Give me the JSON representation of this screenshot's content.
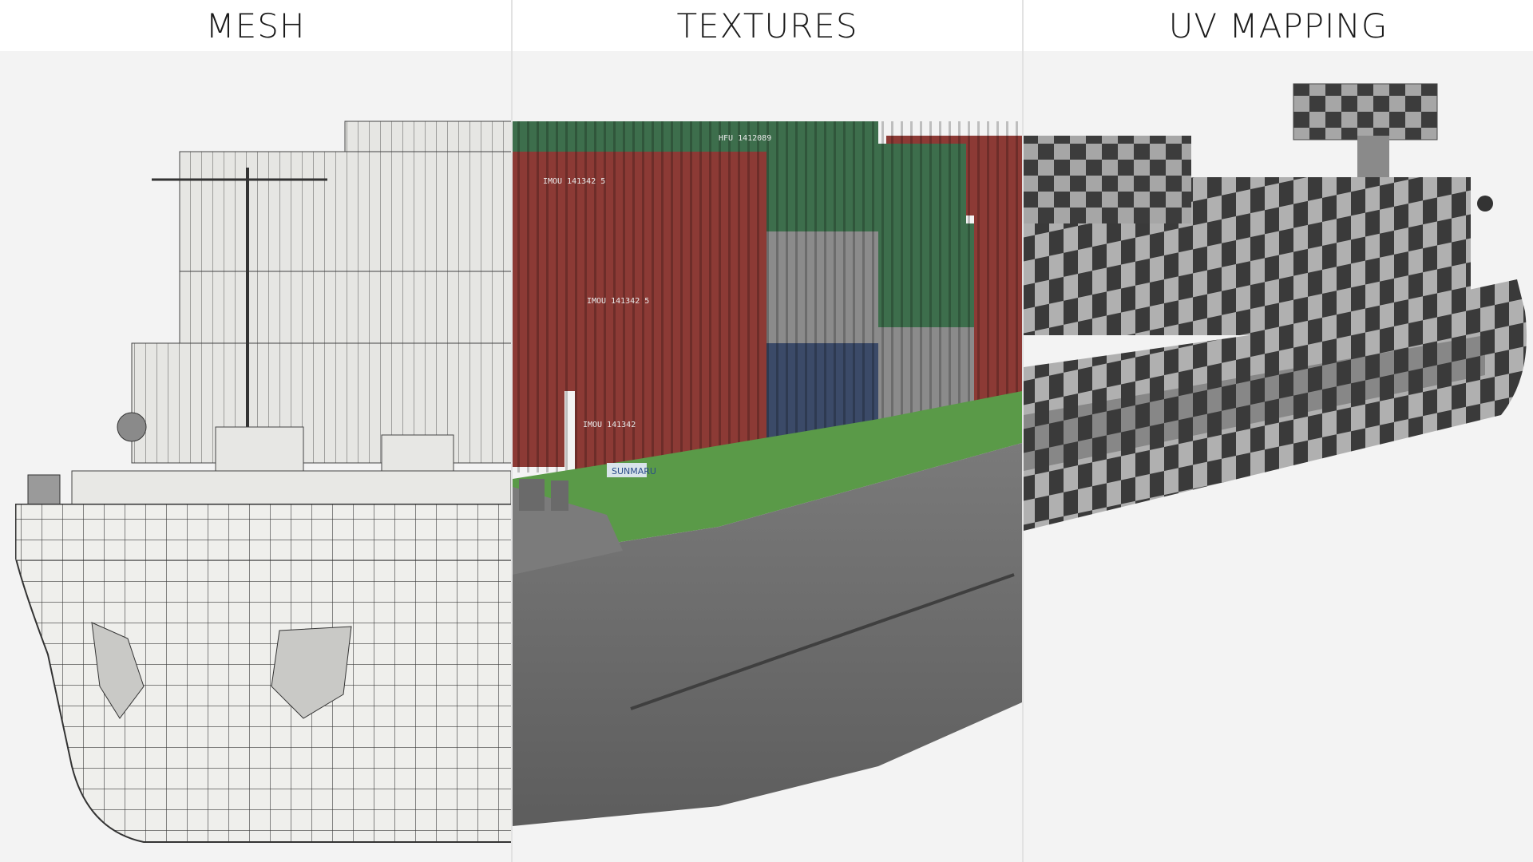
{
  "panels": [
    {
      "id": "mesh",
      "label": "MESH"
    },
    {
      "id": "textures",
      "label": "TEXTURES"
    },
    {
      "id": "uv",
      "label": "UV MAPPING"
    }
  ],
  "container_codes": [
    "IMOU 141342 5",
    "IMOU 141342 5",
    "HFU 1412089",
    "IMOU 141342"
  ],
  "ship_badge": "SUNMARU",
  "colors": {
    "background": "#f3f3f3",
    "header": "#ffffff",
    "mesh_fill": "#ededea",
    "mesh_line": "#3a3a3a",
    "container_red": "#8c3a35",
    "container_green": "#3d6e4c",
    "container_grey": "#8b8b8b",
    "container_blue": "#3b4a68",
    "deck_green": "#5a9a48",
    "hull_grey": "#6f6f6f",
    "uv_dark": "#3d3d3d",
    "uv_light": "#a8a8a8"
  }
}
